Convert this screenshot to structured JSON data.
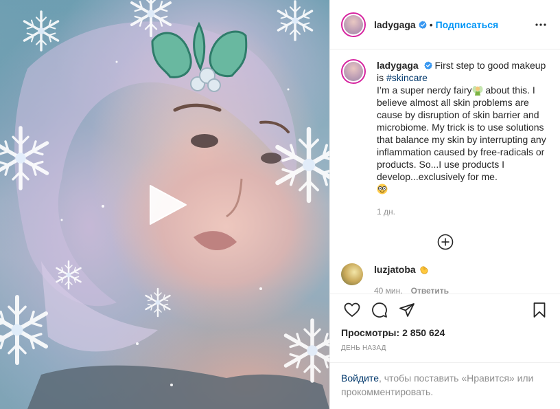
{
  "author": {
    "username": "ladygaga",
    "verified": true,
    "follow_label": "Подписаться",
    "separator": "•"
  },
  "caption": {
    "username": "ladygaga",
    "text_before_tag": "First step to good makeup is ",
    "hashtag": "#skincare",
    "line2_before_emoji": "I’m a super nerdy fairy",
    "line2_after_emoji": " about this. I believe almost all skin problems are cause by disruption of skin barrier and microbiome. My trick is to use solutions that balance my skin by interrupting any inflammation caused by free-radicals or products. So...I use products I develop...exclusively for me.",
    "emojis": [
      "fairy",
      "nerd-face"
    ],
    "age": "1 дн."
  },
  "comment": {
    "username": "luzjatoba",
    "emoji": "clapping-hands",
    "age": "40 мин.",
    "reply_label": "Ответить"
  },
  "stats": {
    "views_label": "Просмотры:",
    "views_value": "2 850 624",
    "date": "День назад"
  },
  "login_prompt": {
    "link": "Войдите",
    "rest": ", чтобы поставить «Нравится» или прокомментировать."
  },
  "colors": {
    "accent": "#0095f6",
    "hashtag": "#00376b",
    "muted": "#8e8e8e",
    "text": "#262626",
    "border": "#efefef"
  },
  "icons": [
    "play-icon",
    "holly-icon",
    "snowflake-icon",
    "verified-icon",
    "more-icon",
    "add-circle-icon",
    "heart-icon",
    "comment-icon",
    "share-icon",
    "bookmark-icon"
  ]
}
